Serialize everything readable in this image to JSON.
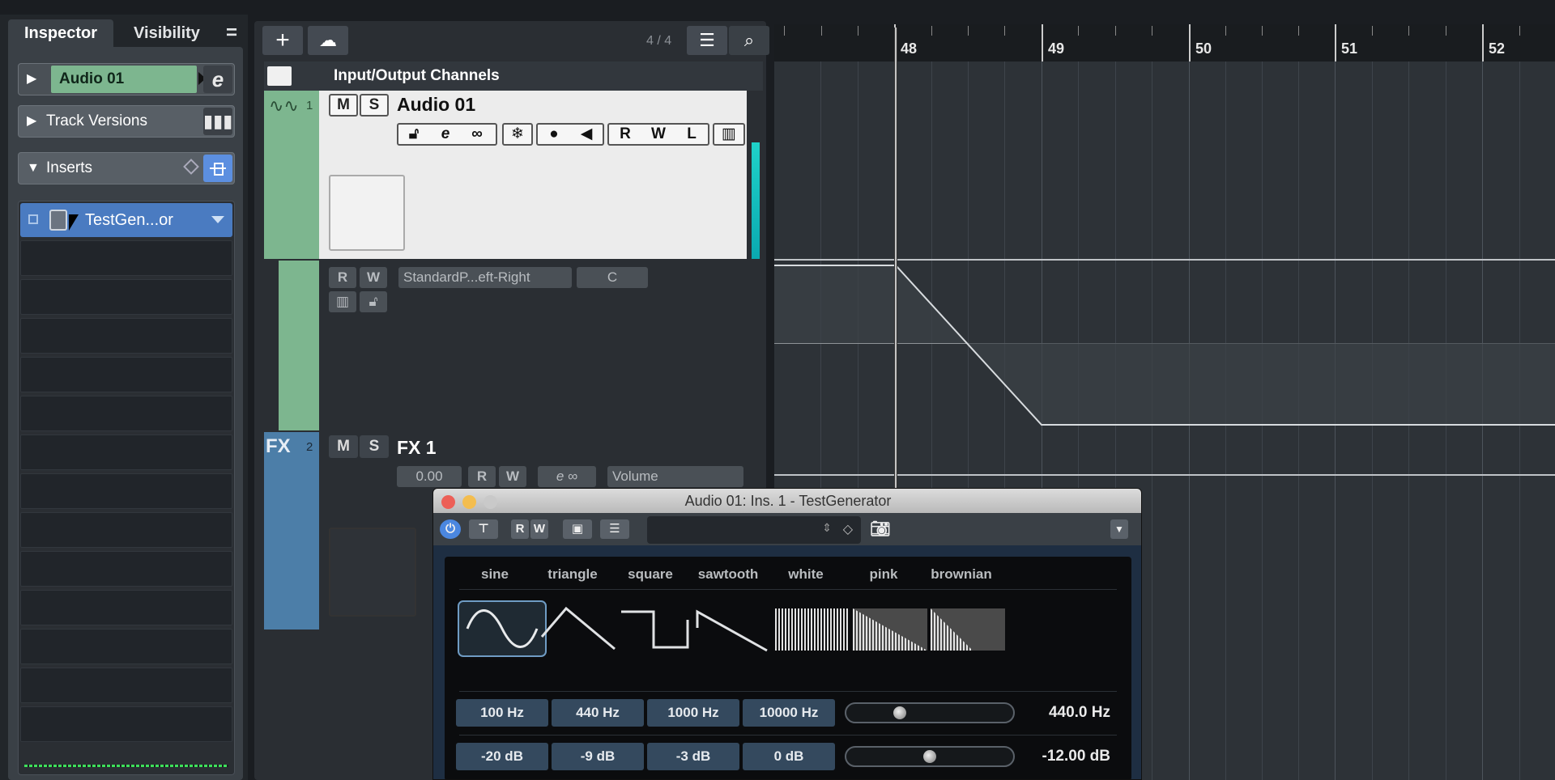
{
  "inspector": {
    "tabs": [
      "Inspector",
      "Visibility"
    ],
    "menu_icon": "=",
    "track_name": "Audio 01",
    "edit_icon": "e",
    "sections": {
      "track_versions": "Track Versions",
      "inserts": "Inserts"
    },
    "insert_slot_1": "TestGen...or"
  },
  "tracklist": {
    "count": "4 / 4",
    "folder": "Input/Output Channels",
    "track1": {
      "number": "1",
      "name": "Audio 01",
      "mute": "M",
      "solo": "S",
      "read": "R",
      "write": "W",
      "lane_read": "R",
      "lane_write": "W",
      "lane_param": "StandardP...eft-Right",
      "lane_value": "C",
      "color": "#7db68f"
    },
    "track2": {
      "label": "FX",
      "number": "2",
      "name": "FX 1",
      "mute": "M",
      "solo": "S",
      "volume": "0.00",
      "read": "R",
      "write": "W",
      "param": "Volume",
      "color": "#4c7ea8"
    }
  },
  "ruler": {
    "bars": [
      "48",
      "49",
      "50",
      "51",
      "52"
    ]
  },
  "plugin": {
    "title": "Audio 01: Ins. 1 - TestGenerator",
    "toolbar": {
      "read": "R",
      "write": "W"
    },
    "waveforms": [
      "sine",
      "triangle",
      "square",
      "sawtooth",
      "white",
      "pink",
      "brownian"
    ],
    "selected_waveform": "sine",
    "frequency_presets": [
      "100 Hz",
      "440 Hz",
      "1000 Hz",
      "10000 Hz"
    ],
    "frequency_value": "440.0 Hz",
    "frequency_slider_fraction": 0.3,
    "level_presets": [
      "-20 dB",
      "-9 dB",
      "-3 dB",
      "0 dB"
    ],
    "level_value": "-12.00 dB",
    "level_slider_fraction": 0.5,
    "accent_color": "#34495e"
  }
}
